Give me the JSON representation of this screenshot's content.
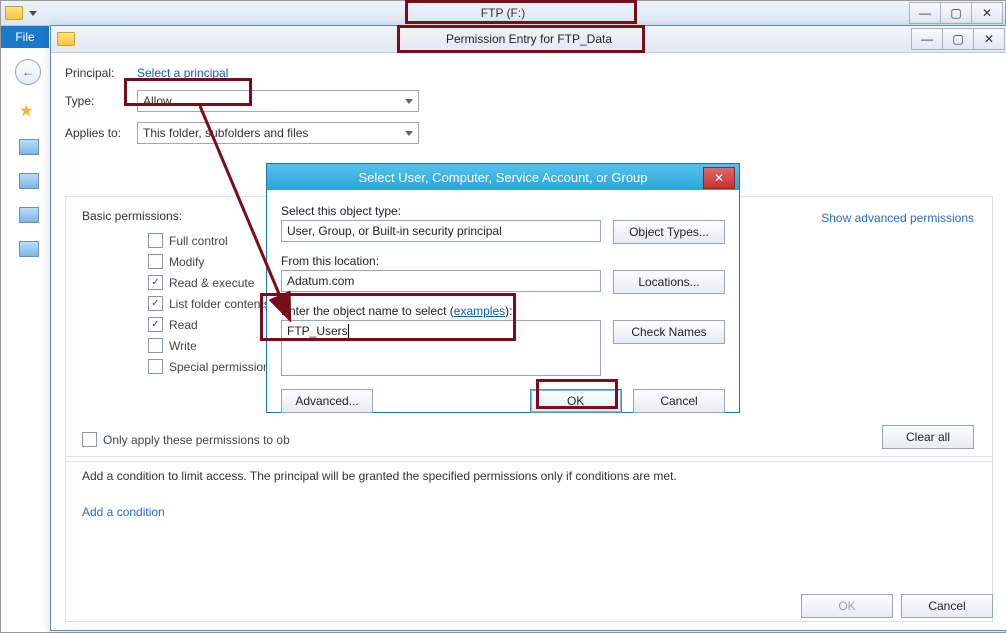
{
  "outer": {
    "title": "FTP (F:)",
    "file_tab": "File"
  },
  "perm": {
    "title": "Permission Entry for FTP_Data",
    "principal_label": "Principal:",
    "select_principal_link": "Select a principal",
    "type_label": "Type:",
    "type_value": "Allow",
    "applies_label": "Applies to:",
    "applies_value": "This folder, subfolders and files",
    "basic_label": "Basic permissions:",
    "show_advanced": "Show advanced permissions",
    "checks": {
      "full": "Full control",
      "modify": "Modify",
      "readexec": "Read & execute",
      "listfolder": "List folder contents",
      "read": "Read",
      "write": "Write",
      "special": "Special permissions"
    },
    "only_apply": "Only apply these permissions to objects and/or containers within this container",
    "only_apply_short": "Only apply these permissions to ob",
    "clear_all": "Clear all",
    "cond_msg": "Add a condition to limit access. The principal will be granted the specified permissions only if conditions are met.",
    "add_condition": "Add a condition",
    "ok": "OK",
    "cancel": "Cancel"
  },
  "seldlg": {
    "title": "Select User, Computer, Service Account, or Group",
    "obj_type_label": "Select this object type:",
    "obj_type_value": "User, Group, or Built-in security principal",
    "obj_types_btn": "Object Types...",
    "loc_label": "From this location:",
    "loc_value": "Adatum.com",
    "loc_btn": "Locations...",
    "enter_label_prefix": "Enter the object name to select (",
    "examples": "examples",
    "enter_label_suffix": "):",
    "entered": "FTP_Users",
    "check_names": "Check Names",
    "advanced": "Advanced...",
    "ok": "OK",
    "cancel": "Cancel"
  }
}
